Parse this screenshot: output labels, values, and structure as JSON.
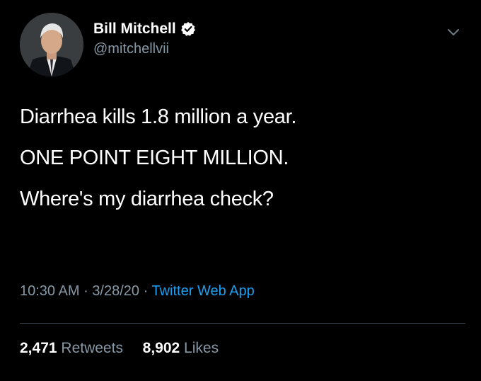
{
  "user": {
    "display_name": "Bill Mitchell",
    "handle": "@mitchellvii",
    "verified": true
  },
  "tweet": {
    "lines": [
      "Diarrhea kills 1.8 million a year.",
      "ONE POINT EIGHT MILLION.",
      "Where's my diarrhea check?"
    ]
  },
  "meta": {
    "time": "10:30 AM",
    "date": "3/28/20",
    "separator": "·",
    "source": "Twitter Web App"
  },
  "stats": {
    "retweets_count": "2,471",
    "retweets_label": "Retweets",
    "likes_count": "8,902",
    "likes_label": "Likes"
  },
  "icons": {
    "verified": "verified-badge-icon",
    "menu": "chevron-down-icon"
  },
  "colors": {
    "background": "#000000",
    "secondary_text": "#8899a6",
    "link": "#1da1f2",
    "divider": "#38444d"
  }
}
